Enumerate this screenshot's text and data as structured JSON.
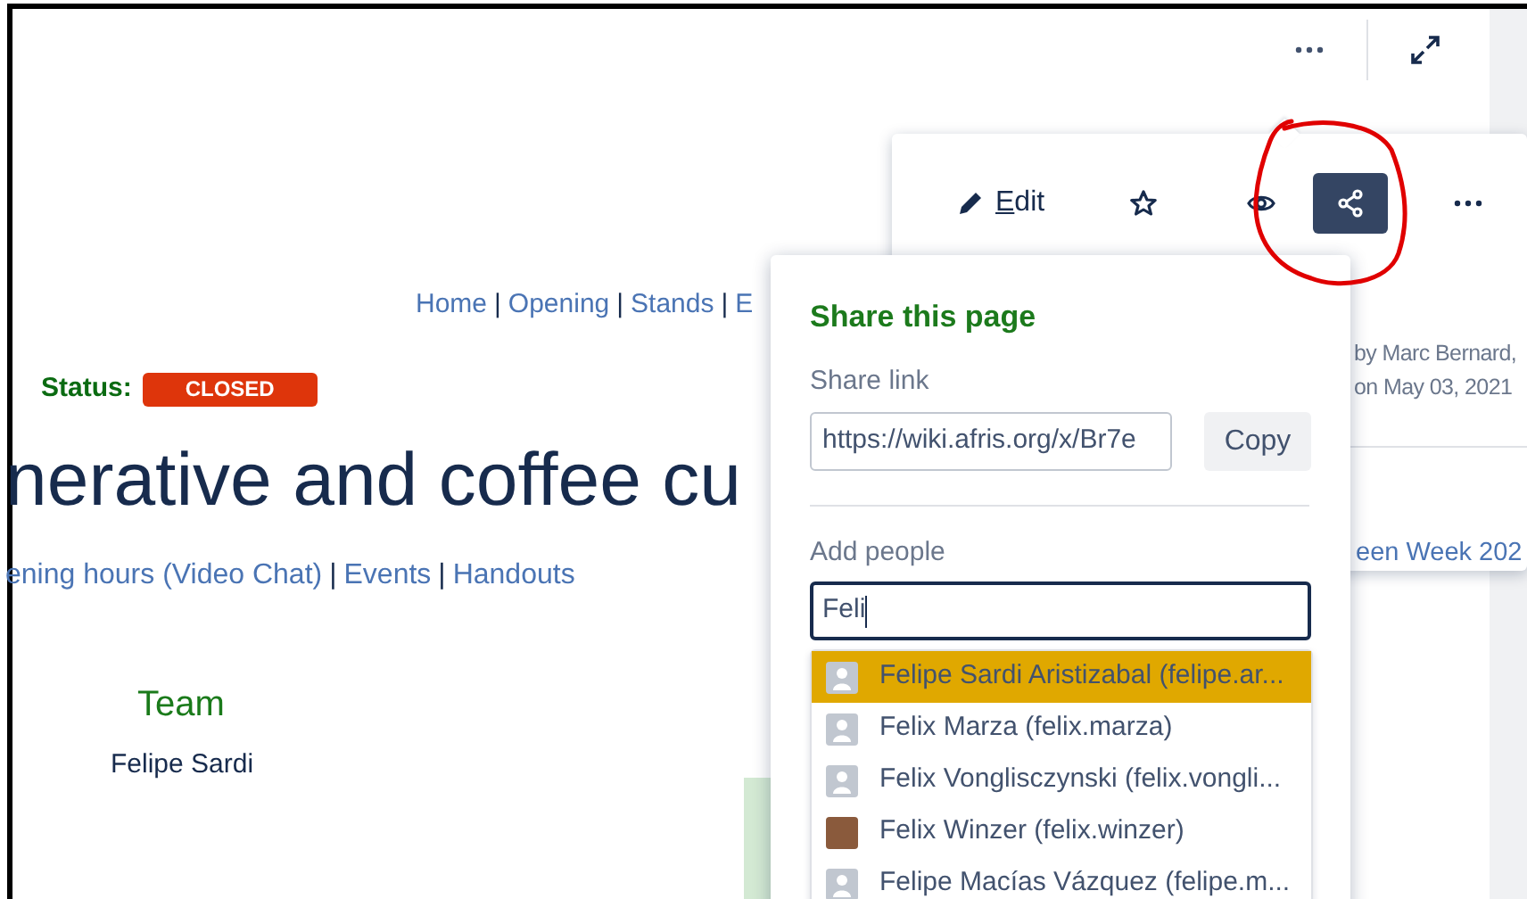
{
  "page": {
    "nav": {
      "separator": "|",
      "links": [
        "Home",
        "Opening",
        "Stands",
        "E"
      ]
    },
    "status": {
      "label": "Status:",
      "badge": "CLOSED"
    },
    "title": "nerative and coffee cu",
    "links": {
      "separator": "|",
      "items": [
        "ening hours (Video Chat)",
        "Events",
        "Handouts"
      ]
    },
    "team": {
      "heading": "Team",
      "members": [
        "Felipe Sardi"
      ]
    }
  },
  "actions_menu": {
    "items": [
      {
        "kind": "edit",
        "label": "Edit",
        "selected": false
      },
      {
        "kind": "star",
        "selected": false
      },
      {
        "kind": "watch",
        "selected": false
      },
      {
        "kind": "share",
        "selected": true
      },
      {
        "kind": "more",
        "selected": false
      }
    ],
    "info": [
      "by Marc Bernard,",
      "on May 03, 2021"
    ],
    "link": "een Week 202"
  },
  "share_dialog": {
    "title": "Share this page",
    "link_label": "Share link",
    "link_value": "https://wiki.afris.org/x/Br7e",
    "copy_label": "Copy",
    "people_label": "Add people",
    "people_value": "Feli",
    "suggestions": [
      {
        "name": "Felipe Sardi Aristizabal (felipe.ar...",
        "kind": "default",
        "selected": true
      },
      {
        "name": "Felix Marza (felix.marza)",
        "kind": "default",
        "selected": false
      },
      {
        "name": "Felix Vonglisczynski (felix.vongli...",
        "kind": "default",
        "selected": false
      },
      {
        "name": "Felix Winzer (felix.winzer)",
        "kind": "photo",
        "selected": false
      },
      {
        "name": "Felipe Macías Vázquez (felipe.m...",
        "kind": "default",
        "selected": false
      }
    ]
  }
}
